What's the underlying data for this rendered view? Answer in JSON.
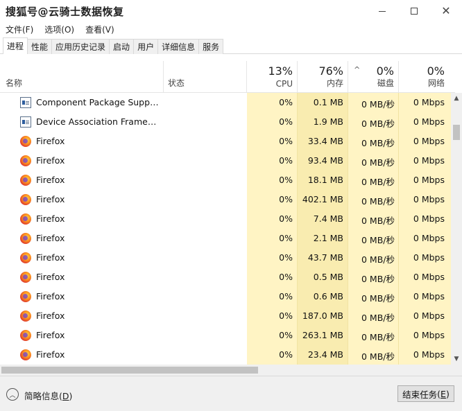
{
  "window": {
    "title": "搜狐号@云骑士数据恢复",
    "icons": {
      "minimize": "minimize-icon",
      "maximize": "maximize-icon",
      "close": "close-icon"
    }
  },
  "menu": {
    "file": "文件(F)",
    "options": "选项(O)",
    "view": "查看(V)"
  },
  "tabs": [
    {
      "label": "进程",
      "active": true
    },
    {
      "label": "性能"
    },
    {
      "label": "应用历史记录"
    },
    {
      "label": "启动"
    },
    {
      "label": "用户"
    },
    {
      "label": "详细信息"
    },
    {
      "label": "服务"
    }
  ],
  "header": {
    "name": "名称",
    "status": "状态",
    "cpu": {
      "percent": "13%",
      "label": "CPU"
    },
    "memory": {
      "percent": "76%",
      "label": "内存"
    },
    "disk": {
      "percent": "0%",
      "label": "磁盘",
      "sort_caret": "^"
    },
    "network": {
      "percent": "0%",
      "label": "网络"
    }
  },
  "rows": [
    {
      "icon": "app-window-icon",
      "name": "Component Package Suppor...",
      "cpu": "0%",
      "memory": "0.1 MB",
      "disk": "0 MB/秒",
      "network": "0 Mbps"
    },
    {
      "icon": "app-window-icon",
      "name": "Device Association Framewo...",
      "cpu": "0%",
      "memory": "1.9 MB",
      "disk": "0 MB/秒",
      "network": "0 Mbps"
    },
    {
      "icon": "firefox-icon",
      "name": "Firefox",
      "cpu": "0%",
      "memory": "33.4 MB",
      "disk": "0 MB/秒",
      "network": "0 Mbps"
    },
    {
      "icon": "firefox-icon",
      "name": "Firefox",
      "cpu": "0%",
      "memory": "93.4 MB",
      "disk": "0 MB/秒",
      "network": "0 Mbps"
    },
    {
      "icon": "firefox-icon",
      "name": "Firefox",
      "cpu": "0%",
      "memory": "18.1 MB",
      "disk": "0 MB/秒",
      "network": "0 Mbps"
    },
    {
      "icon": "firefox-icon",
      "name": "Firefox",
      "cpu": "0%",
      "memory": "402.1 MB",
      "disk": "0 MB/秒",
      "network": "0 Mbps"
    },
    {
      "icon": "firefox-icon",
      "name": "Firefox",
      "cpu": "0%",
      "memory": "7.4 MB",
      "disk": "0 MB/秒",
      "network": "0 Mbps"
    },
    {
      "icon": "firefox-icon",
      "name": "Firefox",
      "cpu": "0%",
      "memory": "2.1 MB",
      "disk": "0 MB/秒",
      "network": "0 Mbps"
    },
    {
      "icon": "firefox-icon",
      "name": "Firefox",
      "cpu": "0%",
      "memory": "43.7 MB",
      "disk": "0 MB/秒",
      "network": "0 Mbps"
    },
    {
      "icon": "firefox-icon",
      "name": "Firefox",
      "cpu": "0%",
      "memory": "0.5 MB",
      "disk": "0 MB/秒",
      "network": "0 Mbps"
    },
    {
      "icon": "firefox-icon",
      "name": "Firefox",
      "cpu": "0%",
      "memory": "0.6 MB",
      "disk": "0 MB/秒",
      "network": "0 Mbps"
    },
    {
      "icon": "firefox-icon",
      "name": "Firefox",
      "cpu": "0%",
      "memory": "187.0 MB",
      "disk": "0 MB/秒",
      "network": "0 Mbps"
    },
    {
      "icon": "firefox-icon",
      "name": "Firefox",
      "cpu": "0%",
      "memory": "263.1 MB",
      "disk": "0 MB/秒",
      "network": "0 Mbps"
    },
    {
      "icon": "firefox-icon",
      "name": "Firefox",
      "cpu": "0%",
      "memory": "23.4 MB",
      "disk": "0 MB/秒",
      "network": "0 Mbps"
    }
  ],
  "footer": {
    "fewer_details_text": "简略信息",
    "fewer_details_key": "D",
    "end_task_text": "结束任务",
    "end_task_key": "E"
  },
  "colors": {
    "cpu_column": "#fff4c4",
    "memory_column": "#f9ecb0"
  }
}
